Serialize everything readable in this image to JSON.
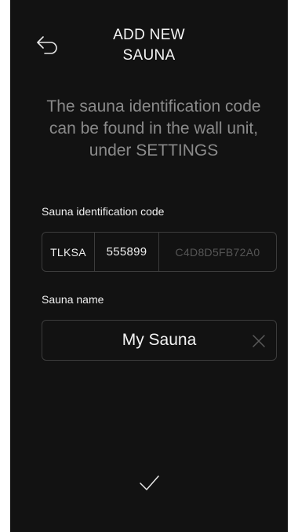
{
  "header": {
    "back_icon": "back-arrow-icon",
    "title_line1": "ADD NEW",
    "title_line2": "SAUNA"
  },
  "instructions": {
    "line1": "The sauna identification code",
    "line2": "can be found in the wall unit,",
    "line3": "under SETTINGS"
  },
  "code_field": {
    "label": "Sauna identification code",
    "prefix": "TLKSA",
    "number": "555899",
    "suffix": "C4D8D5FB72A0"
  },
  "name_field": {
    "label": "Sauna name",
    "value": "My Sauna",
    "clear_icon": "close-icon"
  },
  "footer": {
    "confirm_icon": "checkmark-icon"
  },
  "colors": {
    "background": "#121212",
    "text": "#f2f2f2",
    "muted_text": "#8a8a8a",
    "placeholder_text": "#555555",
    "border": "#3c3c3c"
  }
}
